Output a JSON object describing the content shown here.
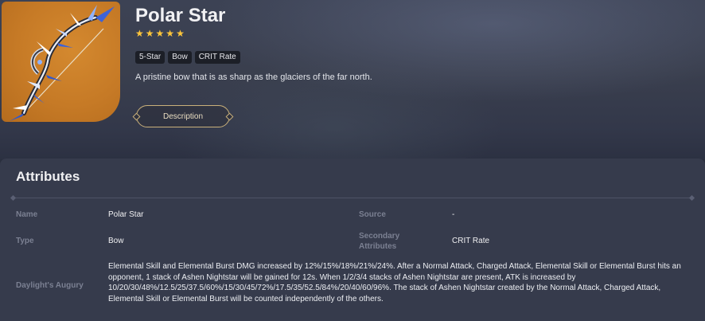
{
  "weapon": {
    "name": "Polar Star",
    "stars": [
      "★",
      "★",
      "★",
      "★",
      "★"
    ],
    "tags": [
      "5-Star",
      "Bow",
      "CRIT Rate"
    ],
    "description": "A pristine bow that is as sharp as the glaciers of the far north.",
    "description_button": "Description",
    "image_icon": "polar-star-bow-icon",
    "star_color": "#ffc63b",
    "accent_color": "#c9b07a"
  },
  "attributes": {
    "heading": "Attributes",
    "name_label": "Name",
    "name_value": "Polar Star",
    "source_label": "Source",
    "source_value": "-",
    "type_label": "Type",
    "type_value": "Bow",
    "secondary_label": "Secondary Attributes",
    "secondary_value": "CRIT Rate",
    "passive_label": "Daylight's Augury",
    "passive_value": "Elemental Skill and Elemental Burst DMG increased by 12%/15%/18%/21%/24%. After a Normal Attack, Charged Attack, Elemental Skill or Elemental Burst hits an opponent, 1 stack of Ashen Nightstar will be gained for 12s. When 1/2/3/4 stacks of Ashen Nightstar are present, ATK is increased by 10/20/30/48%/12.5/25/37.5/60%/15/30/45/72%/17.5/35/52.5/84%/20/40/60/96%. The stack of Ashen Nightstar created by the Normal Attack, Charged Attack, Elemental Skill or Elemental Burst will be counted independently of the others."
  }
}
